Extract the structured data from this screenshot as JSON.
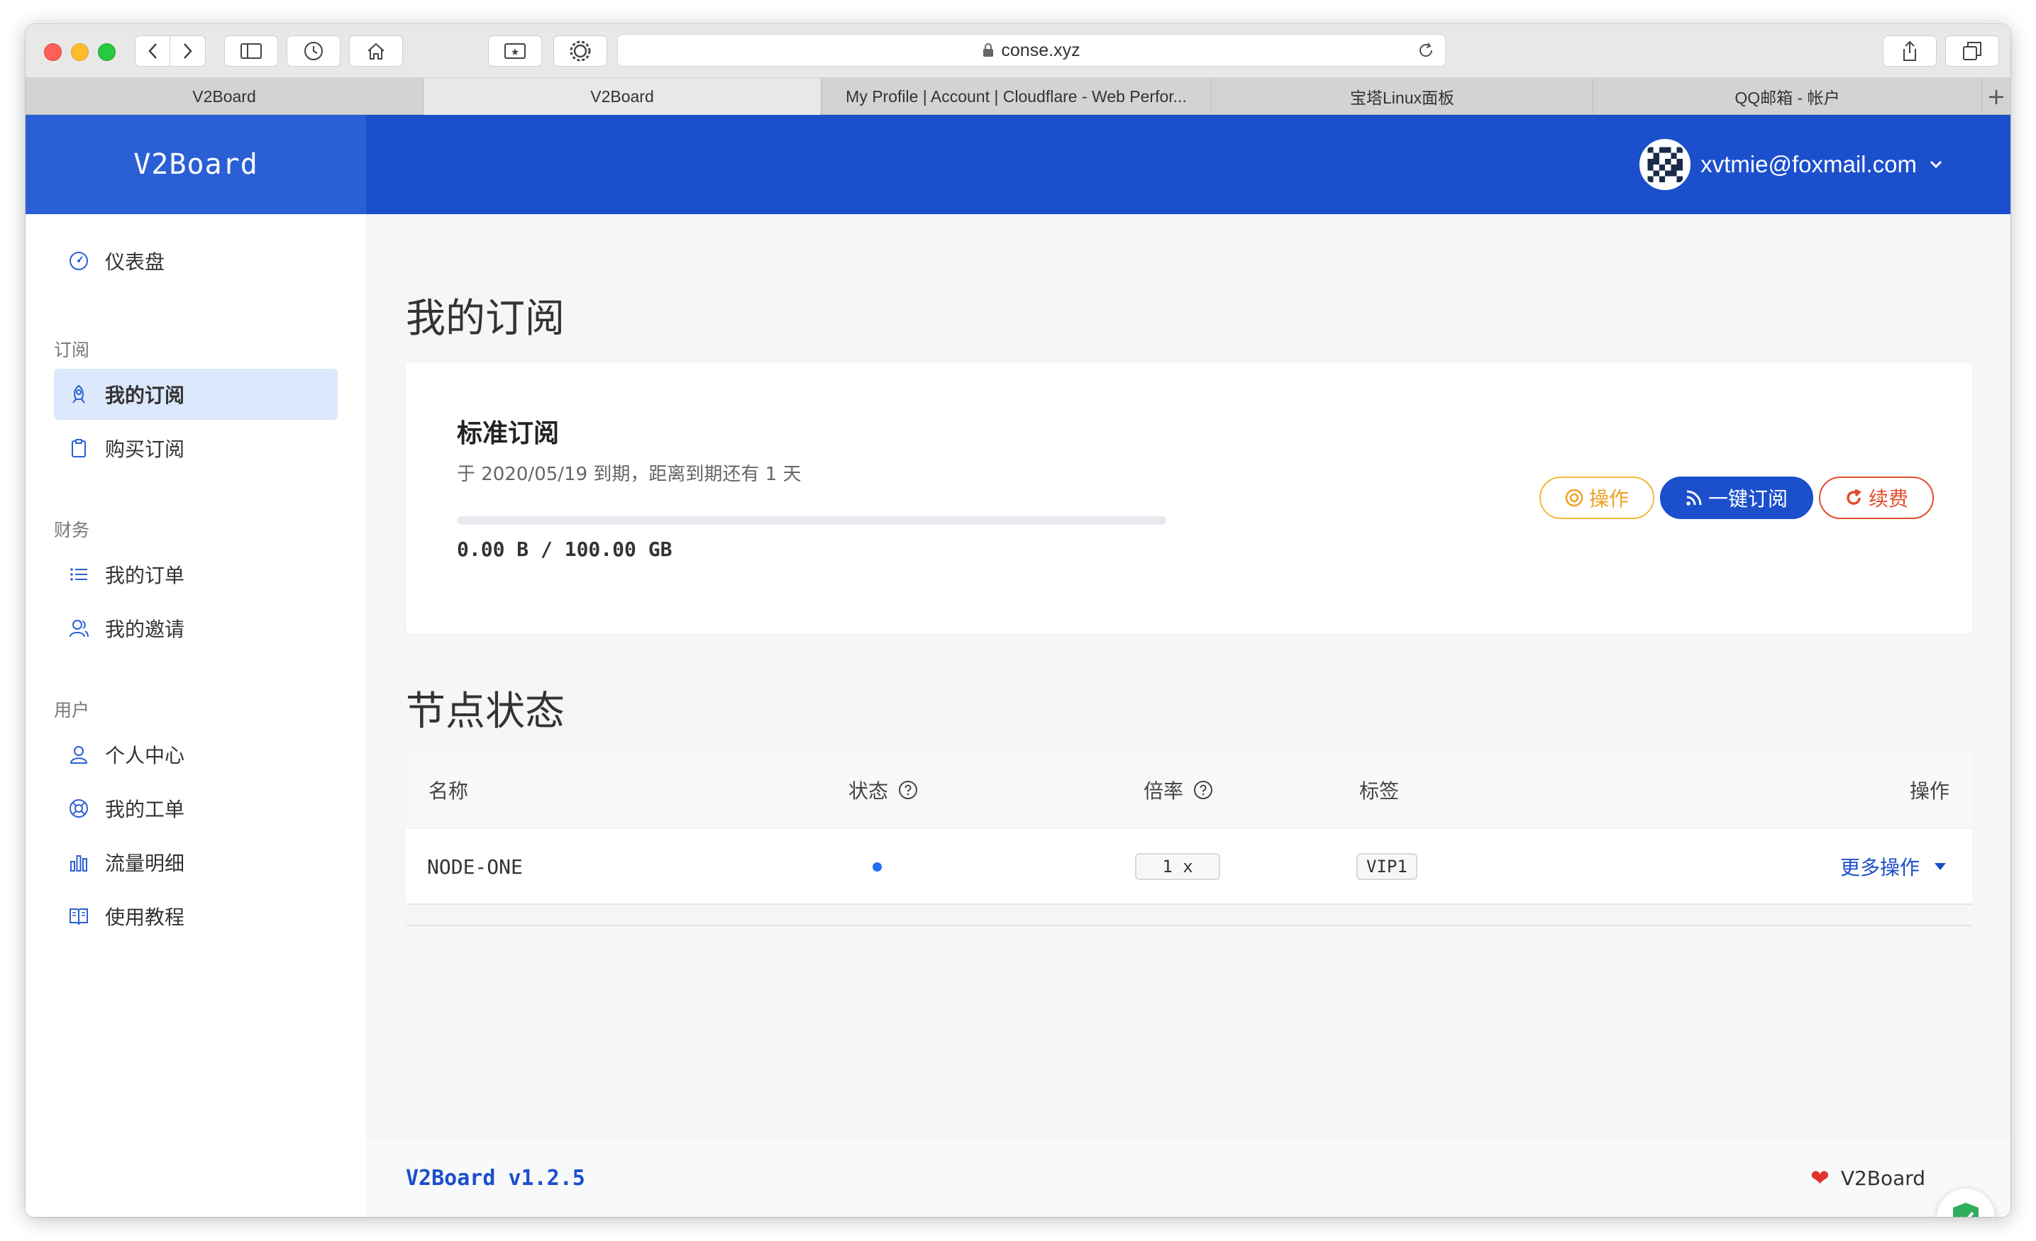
{
  "browser": {
    "url": "conse.xyz",
    "tabs": [
      {
        "label": "V2Board"
      },
      {
        "label": "V2Board"
      },
      {
        "label": "My Profile | Account | Cloudflare - Web Perfor..."
      },
      {
        "label": "宝塔Linux面板"
      },
      {
        "label": "QQ邮箱 - 帐户"
      }
    ]
  },
  "app": {
    "brand": "V2Board",
    "user_email": "xvtmie@foxmail.com"
  },
  "sidebar": {
    "dashboard": "仪表盘",
    "group_subscribe": "订阅",
    "my_subscription": "我的订阅",
    "buy_subscription": "购买订阅",
    "group_finance": "财务",
    "my_orders": "我的订单",
    "my_invites": "我的邀请",
    "group_user": "用户",
    "profile": "个人中心",
    "tickets": "我的工单",
    "traffic": "流量明细",
    "tutorial": "使用教程"
  },
  "subscription": {
    "page_title": "我的订阅",
    "plan_name": "标准订阅",
    "expiry_text": "于 2020/05/19 到期，距离到期还有 1 天",
    "usage_text": "0.00 B / 100.00 GB",
    "usage_fraction": 0,
    "btn_operate": "操作",
    "btn_subscribe": "一键订阅",
    "btn_renew": "续费"
  },
  "nodes": {
    "section_title": "节点状态",
    "columns": {
      "name": "名称",
      "status": "状态",
      "rate": "倍率",
      "tags": "标签",
      "actions": "操作"
    },
    "rows": [
      {
        "name": "NODE-ONE",
        "rate": "1 x",
        "tag": "VIP1",
        "action": "更多操作"
      }
    ]
  },
  "footer": {
    "version": "V2Board v1.2.5",
    "credit": "V2Board"
  },
  "colors": {
    "primary": "#1b4fcc",
    "brand_bg": "#2b5fd6",
    "warning": "#f0a020",
    "danger": "#e04d2c"
  }
}
